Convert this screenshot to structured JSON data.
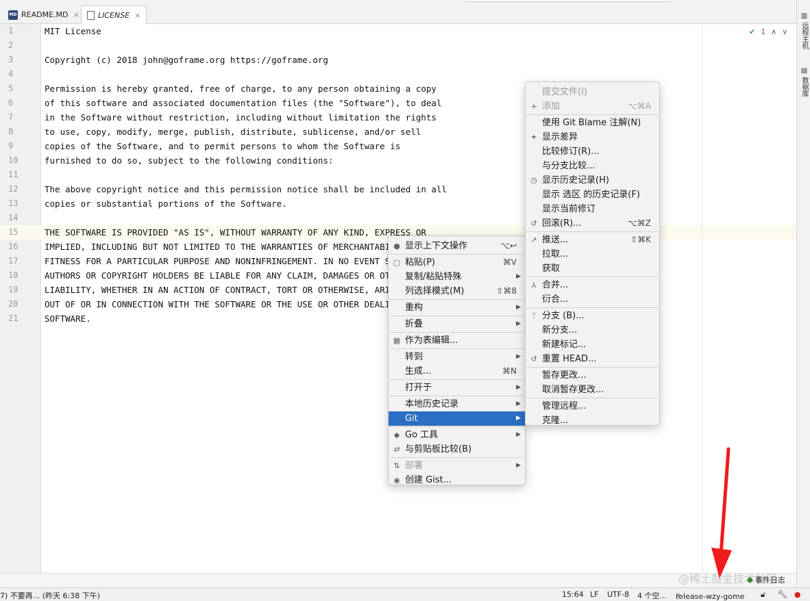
{
  "tabs": [
    {
      "icon_text": "MD",
      "label": "README.MD",
      "close": "×"
    },
    {
      "icon_text": "",
      "label": "LICENSE",
      "close": "×"
    }
  ],
  "editor": {
    "lines": [
      "MIT License",
      "",
      "Copyright (c) 2018 john@goframe.org https://goframe.org",
      "",
      "Permission is hereby granted, free of charge, to any person obtaining a copy",
      "of this software and associated documentation files (the \"Software\"), to deal",
      "in the Software without restriction, including without limitation the rights",
      "to use, copy, modify, merge, publish, distribute, sublicense, and/or sell",
      "copies of the Software, and to permit persons to whom the Software is",
      "furnished to do so, subject to the following conditions:",
      "",
      "The above copyright notice and this permission notice shall be included in all",
      "copies or substantial portions of the Software.",
      "",
      "THE SOFTWARE IS PROVIDED \"AS IS\", WITHOUT WARRANTY OF ANY KIND, EXPRESS OR",
      "IMPLIED, INCLUDING BUT NOT LIMITED TO THE WARRANTIES OF MERCHANTABILITY,",
      "FITNESS FOR A PARTICULAR PURPOSE AND NONINFRINGEMENT. IN NO EVENT SHALL THE",
      "AUTHORS OR COPYRIGHT HOLDERS BE LIABLE FOR ANY CLAIM, DAMAGES OR OTHER",
      "LIABILITY, WHETHER IN AN ACTION OF CONTRACT, TORT OR OTHERWISE, ARISING FROM,",
      "OUT OF OR IN CONNECTION WITH THE SOFTWARE OR THE USE OR OTHER DEALINGS IN THE",
      "SOFTWARE."
    ],
    "line_numbers": [
      "1",
      "2",
      "3",
      "4",
      "5",
      "6",
      "7",
      "8",
      "9",
      "10",
      "11",
      "12",
      "13",
      "14",
      "15",
      "16",
      "17",
      "18",
      "19",
      "20",
      "21"
    ],
    "inspection": {
      "count": "1",
      "up": "∧",
      "down": "∨"
    }
  },
  "context_menu": {
    "items": [
      {
        "icon": "bulb-icon",
        "glyph": "●",
        "label": "显示上下文操作",
        "shortcut": "⌥↩",
        "submenu": false
      },
      {
        "sep": true
      },
      {
        "icon": "paste-icon",
        "glyph": "▢",
        "label": "粘贴(P)",
        "shortcut": "⌘V",
        "submenu": false
      },
      {
        "label": "复制/粘贴特殊",
        "shortcut": "",
        "submenu": true
      },
      {
        "label": "列选择模式(M)",
        "shortcut": "⇧⌘8",
        "submenu": false
      },
      {
        "sep": true
      },
      {
        "label": "重构",
        "shortcut": "",
        "submenu": true
      },
      {
        "sep": true
      },
      {
        "label": "折叠",
        "shortcut": "",
        "submenu": true
      },
      {
        "sep": true
      },
      {
        "icon": "table-icon",
        "glyph": "▦",
        "label": "作为表编辑...",
        "shortcut": "",
        "submenu": false
      },
      {
        "sep": true
      },
      {
        "label": "转到",
        "shortcut": "",
        "submenu": true
      },
      {
        "label": "生成...",
        "shortcut": "⌘N",
        "submenu": false
      },
      {
        "sep": true
      },
      {
        "label": "打开于",
        "shortcut": "",
        "submenu": true
      },
      {
        "sep": true
      },
      {
        "label": "本地历史记录",
        "shortcut": "",
        "submenu": true
      },
      {
        "label": "Git",
        "shortcut": "",
        "submenu": true,
        "selected": true
      },
      {
        "sep": true
      },
      {
        "icon": "go-tools-icon",
        "glyph": "◆",
        "label": "Go 工具",
        "shortcut": "",
        "submenu": true
      },
      {
        "icon": "compare-clipboard-icon",
        "glyph": "⇄",
        "label": "与剪贴板比较(B)",
        "shortcut": "",
        "submenu": false
      },
      {
        "sep": true
      },
      {
        "icon": "deploy-icon",
        "glyph": "⇅",
        "label": "部署",
        "shortcut": "",
        "submenu": true,
        "disabled": true
      },
      {
        "icon": "github-icon",
        "glyph": "◉",
        "label": "创建 Gist...",
        "shortcut": "",
        "submenu": false
      }
    ]
  },
  "git_menu": {
    "items": [
      {
        "label": "提交文件(I)",
        "shortcut": "",
        "disabled": true
      },
      {
        "icon": "plus-icon",
        "glyph": "+",
        "label": "添加",
        "shortcut": "⌥⌘A",
        "disabled": true
      },
      {
        "sep": true
      },
      {
        "label": "使用 Git Blame 注解(N)",
        "shortcut": ""
      },
      {
        "icon": "diff-icon",
        "glyph": "✦",
        "label": "显示差异",
        "shortcut": ""
      },
      {
        "label": "比较修订(R)...",
        "shortcut": ""
      },
      {
        "label": "与分支比较...",
        "shortcut": ""
      },
      {
        "icon": "history-icon",
        "glyph": "◷",
        "label": "显示历史记录(H)",
        "shortcut": ""
      },
      {
        "label": "显示 选区 的历史记录(F)",
        "shortcut": ""
      },
      {
        "label": "显示当前修订",
        "shortcut": ""
      },
      {
        "icon": "rollback-icon",
        "glyph": "↺",
        "label": "回滚(R)...",
        "shortcut": "⌥⌘Z"
      },
      {
        "sep": true
      },
      {
        "icon": "push-icon",
        "glyph": "↗",
        "label": "推送...",
        "shortcut": "⇧⌘K"
      },
      {
        "label": "拉取...",
        "shortcut": ""
      },
      {
        "label": "获取",
        "shortcut": ""
      },
      {
        "sep": true
      },
      {
        "icon": "merge-icon",
        "glyph": "⅄",
        "label": "合并...",
        "shortcut": ""
      },
      {
        "label": "衍合...",
        "shortcut": ""
      },
      {
        "sep": true
      },
      {
        "icon": "branch-icon",
        "glyph": "ᛘ",
        "label": "分支 (B)...",
        "shortcut": ""
      },
      {
        "label": "新分支...",
        "shortcut": ""
      },
      {
        "label": "新建标记...",
        "shortcut": ""
      },
      {
        "icon": "reset-icon",
        "glyph": "↺",
        "label": "重置 HEAD...",
        "shortcut": ""
      },
      {
        "sep": true
      },
      {
        "label": "暂存更改...",
        "shortcut": ""
      },
      {
        "label": "取消暂存更改...",
        "shortcut": ""
      },
      {
        "sep": true
      },
      {
        "label": "管理远程...",
        "shortcut": ""
      },
      {
        "label": "克隆...",
        "shortcut": ""
      }
    ]
  },
  "right_strip": {
    "remote_host": "远程主机",
    "database": "数据库"
  },
  "status_bar": {
    "message": "7)  不要再... (昨天 6:38 下午)",
    "position": "15:64",
    "line_sep": "LF",
    "encoding": "UTF-8",
    "indent": "4 个空...",
    "branch": "release-wzy-gome",
    "event_log": "事件日志"
  },
  "watermark": "@稀土掘金技术社区",
  "colors": {
    "selection": "#2a6fc3",
    "arrow": "#ee1c1c",
    "current_line": "#fcfaed"
  }
}
